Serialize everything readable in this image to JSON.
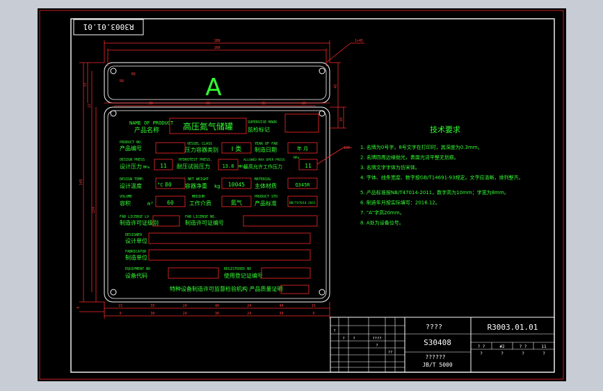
{
  "drawing_code_stamp": "R3003.01.01",
  "plate": {
    "big_letter": "A",
    "main_title": "高压氮气储罐",
    "product_name_en": "NAME OF PRODUCT",
    "product_name_cn": "产品名称",
    "supervise_en": "SUPERVISE MARK",
    "supervise_cn": "监检标记",
    "fields": {
      "product_no_en": "PRODUCT NO.",
      "product_no_cn": "产品编号",
      "vessel_class_en": "VESSEL CLASS",
      "vessel_class_cn": "压力容器类别",
      "vessel_class_value": "I 类",
      "year_en": "YEAR OF FAB",
      "year_cn": "制造日期",
      "year_value": "年 月",
      "design_press_en": "DESIGN PRESS",
      "design_press_cn": "设计压力",
      "design_press_unit": "MPa",
      "design_press_value": "11",
      "hydro_en": "HYDROTEST PRESS.",
      "hydro_cn": "耐压试验压力",
      "hydro_value": "13.8",
      "hydro_unit": "MPa",
      "allow_en": "ALLOWED MAX OPER PRESS",
      "allow_cn": "最高允许工作压力",
      "allow_value": "11",
      "allow_unit": "MPa",
      "design_temp_en": "DESIGN TEMP.",
      "design_temp_cn": "设计温度",
      "design_temp_value": "80",
      "design_temp_unit": "°C",
      "weight_en": "NET WEIGHT",
      "weight_cn": "容器净重",
      "weight_unit": "kg",
      "weight_value": "10045",
      "material_en": "MATERIAL",
      "material_cn": "主体材质",
      "material_value": "Q345R",
      "volume_en": "VOLUME",
      "volume_cn": "容积",
      "volume_unit": "m³",
      "volume_value": "60",
      "medium_en": "MEDIUM",
      "medium_cn": "工作介质",
      "medium_value": "氮气",
      "std_en": "PRODUCT STD",
      "std_cn": "产品标准",
      "std_value": "NB/T47014-2011",
      "fab_license_en": "FAB LICENSE LV",
      "fab_license_cn": "制造许可证级别",
      "fab_license2_en": "FAB LICENSE NO.",
      "fab_license2_cn": "制造许可证编号",
      "designer_en": "DESIGNER",
      "designer_cn": "设计单位",
      "fabricator_en": "FABRICATOR",
      "fabricator_cn": "制造单位",
      "equip_en": "EQUIPMENT NO",
      "equip_cn": "设备代码",
      "reg_en": "REGISTERED NO",
      "reg_cn": "使用登记证编号",
      "footer": "特种设备制造许可监督检验机构 产品质量证明"
    }
  },
  "dimensions": {
    "top_total": "188",
    "top_inner": "168",
    "chamfer": "1×45",
    "radius1": "R6",
    "radius2": "R8",
    "d30": "30",
    "d60": "60",
    "d35": "35",
    "d20": "20",
    "bottom": [
      "15",
      "35",
      "24",
      "40",
      "24",
      "40",
      "15"
    ],
    "bottom2": [
      "9",
      "30",
      "24",
      "38",
      "24",
      "30",
      "9"
    ],
    "left_v": [
      "33",
      "22",
      "145",
      "124",
      "6"
    ],
    "right_v": [
      "45",
      "10"
    ],
    "tag_100": "100"
  },
  "requirements": {
    "title": "技术要求",
    "items": [
      "1. 名牌为0号字，8号文字在打印时，其深度为0.3mm。",
      "2. 名牌四周边缘抛光，表面光洁平整无划痕。",
      "3. 名牌文字字体为仿宋体。",
      "4. 字体、线条宽度、数字按GB/T14691-93规定。文字应清晰，排列整齐。",
      "5. 产品标准按NB/T47014-2011，数字高为10mm；字宽为8mm。",
      "6. 制造年月按实际填写：2016.12。",
      "7. \"A\"字高20mm。",
      "8. A处为设备位号。"
    ]
  },
  "title_block": {
    "name_q": "????",
    "drawing_no": "R3003.01.01",
    "material": "S30408",
    "std_q": "??????",
    "std": "JB/T 5000",
    "cells": [
      "?",
      "?",
      "?",
      "?",
      "??",
      "????"
    ],
    "row_vals": [
      "? ?",
      "#2",
      "? ?",
      "11"
    ],
    "row_vals2": [
      "?",
      "?",
      "?",
      "?"
    ]
  }
}
